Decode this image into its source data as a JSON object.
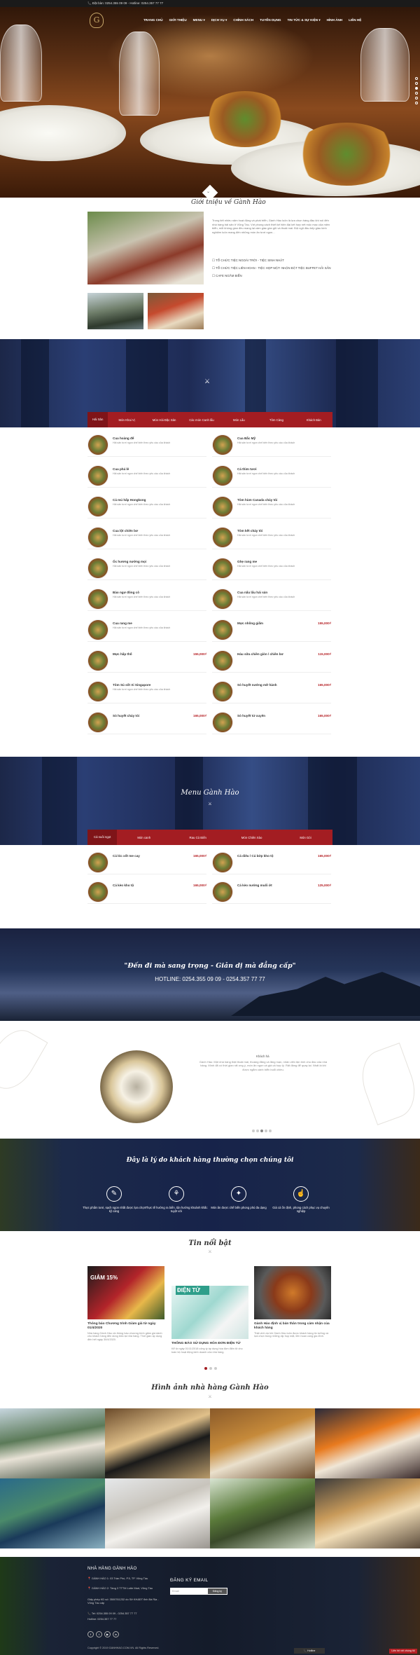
{
  "topbar": {
    "text": "📞 Đặt bàn: 0254.355 09 09 - Hotline: 0254.357 77 77"
  },
  "nav": {
    "logo": "G",
    "items": [
      "TRANG CHỦ",
      "GIỚI THIỆU",
      "MENU ▾",
      "DỊCH VỤ ▾",
      "CHÍNH SÁCH",
      "TUYỂN DỤNG",
      "TIN TỨC & SỰ KIỆN ▾",
      "HÌNH ẢNH",
      "LIÊN HỆ"
    ]
  },
  "about": {
    "title": "Giới thiệu về Gành Hào",
    "paragraph": "Trong tiết nhiều năm hoạt động và phát triển, Gành Hào luôn là lựa chọn hàng đầu khi nói đến nhà hàng hải sản ở Vũng Tàu. Với phong cách thiết kế hiện đại kết hợp nét mộc mạc của miền biển, mỗi không gian đều mang lại cảm giác gần gũi và thoải mái. Đội ngũ đầu bếp giàu kinh nghiệm luôn mang đến những món ăn tươi ngon...",
    "services": [
      "TỔ CHỨC TIỆC NGOÀI TRỜI - TIỆC SINH NHẬT",
      "TỔ CHỨC TIỆC LIÊN HOAN - TIỆC HỌP MẶT- NHẬN ĐẶT TIỆC BUFFET HẢI SẢN",
      "CAFE NGẮM BIỂN"
    ]
  },
  "tabs1": [
    "Hải Sản",
    "Món Khai Vị",
    "Món Hải Đặc Sản",
    "Các món Canh lẩu",
    "Món Lẩu",
    "Tôm Càng",
    "Khách Bàn"
  ],
  "menu1_left": [
    {
      "name": "Cua hoàng đế",
      "desc": "Hải sản tươi ngon chế biến theo yêu cầu của khách",
      "price": ""
    },
    {
      "name": "Cua phá lê",
      "desc": "Hải sản tươi ngon chế biến theo yêu cầu của khách",
      "price": ""
    },
    {
      "name": "Cá mú hấp Hongkong",
      "desc": "Hải sản tươi ngon chế biến theo yêu cầu của khách",
      "price": ""
    },
    {
      "name": "Cua lột chiên bơ",
      "desc": "Hải sản tươi ngon chế biến theo yêu cầu của khách",
      "price": ""
    },
    {
      "name": "Ốc hương nướng mọi",
      "desc": "Hải sản tươi ngon chế biến theo yêu cầu của khách",
      "price": ""
    },
    {
      "name": "Bào ngư đông cô",
      "desc": "Hải sản tươi ngon chế biến theo yêu cầu của khách",
      "price": ""
    },
    {
      "name": "Cua rang me",
      "desc": "Hải sản tươi ngon chế biến theo yêu cầu của khách",
      "price": ""
    },
    {
      "name": "Mực hấp thố",
      "desc": "",
      "price": "155,000₫"
    },
    {
      "name": "Tôm Sú sốt Xi Singapore",
      "desc": "Hải sản tươi ngon chế biến theo yêu cầu của khách",
      "price": ""
    },
    {
      "name": "Sò huyết cháy tỏi",
      "desc": "",
      "price": "165,000₫"
    }
  ],
  "menu1_right": [
    {
      "name": "Cua Bắc Mỹ",
      "desc": "Hải sản tươi ngon chế biến theo yêu cầu của khách",
      "price": ""
    },
    {
      "name": "Cá thìm tươi",
      "desc": "Hải sản tươi ngon chế biến theo yêu cầu của khách",
      "price": ""
    },
    {
      "name": "Tôm hùm Canada cháy tỏi",
      "desc": "Hải sản tươi ngon chế biến theo yêu cầu của khách",
      "price": ""
    },
    {
      "name": "Tôm kết cháy tỏi",
      "desc": "Hải sản tươi ngon chế biến theo yêu cầu của khách",
      "price": ""
    },
    {
      "name": "Ghẹ rang me",
      "desc": "Hải sản tươi ngon chế biến theo yêu cầu của khách",
      "price": ""
    },
    {
      "name": "Cua nấu lẩu hải sản",
      "desc": "Hải sản tươi ngon chế biến theo yêu cầu của khách",
      "price": ""
    },
    {
      "name": "Mực nhồng giấm",
      "desc": "",
      "price": "155,000₫"
    },
    {
      "name": "Hàu sữa chiên giòn / chiên bơ",
      "desc": "",
      "price": "115,000₫"
    },
    {
      "name": "Sò huyết nướng mỡ hành",
      "desc": "",
      "price": "165,000₫"
    },
    {
      "name": "Sò huyết tứ xuyên",
      "desc": "",
      "price": "165,000₫"
    }
  ],
  "menu2": {
    "title": "Menu Gành Hào",
    "tabs": [
      "Cá nuôi ngọt",
      "Món canh",
      "Rau Củ Biển",
      "Món Chiên Xào",
      "Món Gỏi"
    ],
    "left": [
      {
        "name": "Cá lóc xốt me cay",
        "price": "165,000₫"
      },
      {
        "name": "Cá kèo kho tộ",
        "price": "165,000₫"
      }
    ],
    "right": [
      {
        "name": "Cá diêu / Cá bớp kho tộ",
        "price": "165,000₫"
      },
      {
        "name": "Cá kèo nướng muối ớt",
        "price": "125,000₫"
      }
    ]
  },
  "quote": {
    "text": "\"Đến đi mà sang trọng - Giản dị mà đẳng cấp\"",
    "hotline": "HOTLINE: 0254.355 09 09 - 0254.357 77 77"
  },
  "testimonial": {
    "name": "Khách hà",
    "text": "Gành Hào: Một nhà hàng thật thoải mái, thoáng đãng và lãng mạn, nhân viên tận tình chu đáo của nhà hàng. Mình đã có thời gian rất ưng ý, món ăn ngon và giá cả hợp lý. Rất đáng để quay lại. Nhất là khi được ngắm cảnh biển buổi chiều."
  },
  "why": {
    "title": "Đây là lý do khách hàng thường chọn chúng tôi",
    "items": [
      {
        "icon": "✎",
        "text": "Thực phẩm tươi, sạch ngon nhất được lựa chọn kỹ càng"
      },
      {
        "icon": "⚘",
        "text": "Thực tế hướng ra biển, tận hưởng khoảnh khắc tuyệt vời"
      },
      {
        "icon": "✦",
        "text": "Món ăn được chế biến phong phú đa dạng"
      },
      {
        "icon": "☝",
        "text": "Giá cả ổn định, phong cách phục vụ chuyên nghiệp"
      }
    ]
  },
  "news": {
    "title": "Tin nổi bật",
    "items": [
      {
        "title": "Thông báo Chương trình Giảm giá từ ngày 01/4/2020",
        "excerpt": "Nhà hàng Gành Hào xin thông báo chương trình giảm giá dành cho khách hàng đến dùng bữa tại nhà hàng. Thời gian áp dụng đến hết ngày 30/4/2020."
      },
      {
        "title": "THÔNG BÁO SỬ DỤNG HÓA ĐƠN ĐIỆN TỬ",
        "excerpt": "Kể từ ngày 01/11/2018 công ty áp dụng hóa đơn điện tử cho toàn bộ hoạt động kinh doanh của nhà hàng."
      },
      {
        "title": "Gành Hào định vị bản thân trong cảm nhận của khách hàng",
        "excerpt": "Thật vinh dự khi Gành Hào luôn được khách hàng tin tưởng và lựa chọn trong những dịp họp mặt, liên hoan cùng gia đình."
      }
    ],
    "img_labels": [
      "GIẢM 15%",
      "ĐIỆN TỬ",
      ""
    ]
  },
  "gallery": {
    "title": "Hình ảnh nhà hàng Gành Hào"
  },
  "footer": {
    "brand": "NHÀ HÀNG GÀNH HÀO",
    "lines": [
      "📍 GÀNH HÀO 1: 03 Trần Phú, P.5, TP. Vũng Tàu",
      "📍 GÀNH HÀO 2: Tầng 3 TTTM Lotte Mart, Vũng Tàu",
      "Giấy phép KD số: 3500761232 do Sở KH&ĐT tỉnh Bà Rịa - Vũng Tàu cấp",
      "📞 Tel: 0254.355 09 09 - 0254.357 77 77",
      "Hotline: 0254.357 77 77"
    ],
    "subscribe": "ĐĂNG KÝ EMAIL",
    "email_placeholder": "Email",
    "send": "Đăng ký",
    "social": [
      "f",
      "t",
      "▶",
      "in"
    ],
    "copyright": "Copyright © 2019 GANHHAO.COM.VN. All Rights Reserved.",
    "hotline_btn": "📞 Hotline",
    "contact_btn": "Liên hệ với chúng tôi"
  },
  "colors": {
    "accent": "#a31d22",
    "price": "#b52025",
    "navy": "#1e2b55"
  }
}
